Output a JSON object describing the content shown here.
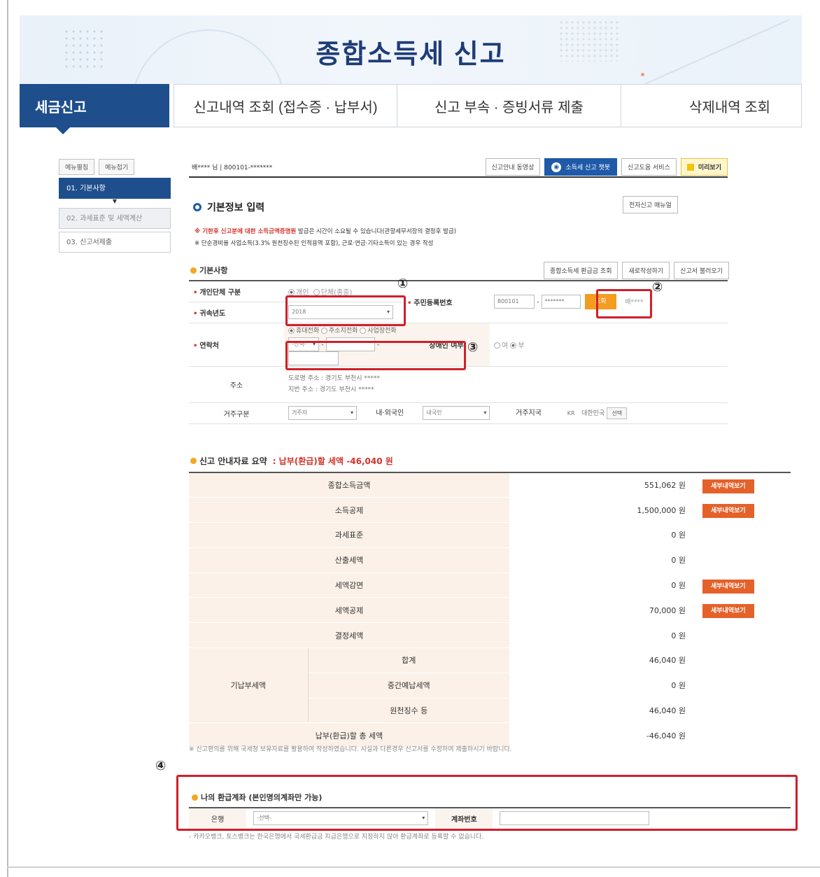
{
  "banner": {
    "title": "종합소득세 신고"
  },
  "tabs": [
    {
      "label": "세금신고"
    },
    {
      "label": "신고내역 조회 (접수증 · 납부서)"
    },
    {
      "label": "신고 부속 · 증빙서류 제출"
    },
    {
      "label": "삭제내역 조회"
    }
  ],
  "left_menu": {
    "expand_label": "메뉴펼침",
    "collapse_label": "메뉴접기",
    "items": [
      {
        "label": "01. 기본사항"
      },
      {
        "label": "02. 과세표준 및 세액계산"
      },
      {
        "label": "03. 신고서제출"
      }
    ]
  },
  "user_bar": {
    "info": "배**** 님  |  800101-*******",
    "buttons": {
      "video": "신고안내 동영상",
      "chatbot": "소득세 신고 챗봇",
      "help_service": "신고도움 서비스",
      "preview": "미리보기"
    }
  },
  "section": {
    "title": "기본정보 입력",
    "manual_button": "전자신고 매뉴얼",
    "notice_1_red": "※ 기한후 신고분에 대한 소득금액증명원",
    "notice_1_rest": " 발급은 시간이 소요될 수 있습니다(관할세무서장의 결정후 발급)",
    "notice_2": "※ 단순경비율 사업소득(3.3% 원천징수된 인적용역 포함), 근로·연금·기타소득이 있는 경우 작성"
  },
  "basic_info": {
    "title": "기본사항",
    "buttons": {
      "refund_query": "종합소득세 환급금 조회",
      "rewrite": "새로작성하기",
      "load": "신고서 불러오기"
    },
    "person_type_label": "개인단체 구분",
    "person_type_options": [
      "개인",
      "단체(종중)"
    ],
    "tax_year_label": "귀속년도",
    "tax_year_value": "2018",
    "rrn_label": "주민등록번호",
    "rrn_front": "800101",
    "rrn_back": "*******",
    "query_button": "조회",
    "name_value": "배****",
    "contact_label": "연락처",
    "contact_options": [
      "휴대전화",
      "주소지전화",
      "사업장전화"
    ],
    "contact_select": "-선택-",
    "disabled_label": "장애인 여부",
    "disabled_options": [
      "여",
      "부"
    ],
    "address_label": "주소",
    "road_address": "도로명 주소 :  경기도 부천시 *****",
    "lot_address": "지번 주소 :  경기도 부천시 *****",
    "residence_label": "거주구분",
    "residence_value": "거주자",
    "nationality_label": "내·외국인",
    "nationality_value": "내국인",
    "country_label": "거주지국",
    "country_code": "KR",
    "country_name": "대한민국",
    "country_select_button": "선택"
  },
  "annotations": [
    "①",
    "②",
    "③",
    "④"
  ],
  "summary": {
    "title": "신고 안내자료 요약",
    "highlight": ": 납부(환급)할 세액 -46,040 원",
    "detail_button": "세부내역보기",
    "unit": "원",
    "rows": [
      {
        "label": "종합소득금액",
        "value": "551,062"
      },
      {
        "label": "소득공제",
        "value": "1,500,000"
      },
      {
        "label": "과세표준",
        "value": "0"
      },
      {
        "label": "산출세액",
        "value": "0"
      },
      {
        "label": "세액감면",
        "value": "0"
      },
      {
        "label": "세액공제",
        "value": "70,000"
      },
      {
        "label": "결정세액",
        "value": "0"
      }
    ],
    "prepaid_label": "기납부세액",
    "prepaid_rows": [
      {
        "label": "합계",
        "value": "46,040"
      },
      {
        "label": "중간예납세액",
        "value": "0"
      },
      {
        "label": "원천징수 등",
        "value": "46,040"
      }
    ],
    "total_label": "납부(환급)할 총 세액",
    "total_value": "-46,040",
    "note": "※ 신고편의를 위해 국세청 보유자료를 활용하여 작성하였습니다. 사실과 다른경우 신고서를 수정하여 제출하시기 바랍니다."
  },
  "refund_account": {
    "title": "나의 환급계좌 (본인명의계좌만 가능)",
    "bank_label": "은행",
    "bank_select": "-선택-",
    "account_label": "계좌번호",
    "note": "- 카카오뱅크, 토스뱅크는 한국은행에서 국세환급금 지급은행으로 지정하지 않아 환급계좌로 등록할 수 없습니다."
  },
  "colors": {
    "primary": "#1e4f8c",
    "accent": "#e5612a",
    "annotation": "#d01f2a"
  }
}
